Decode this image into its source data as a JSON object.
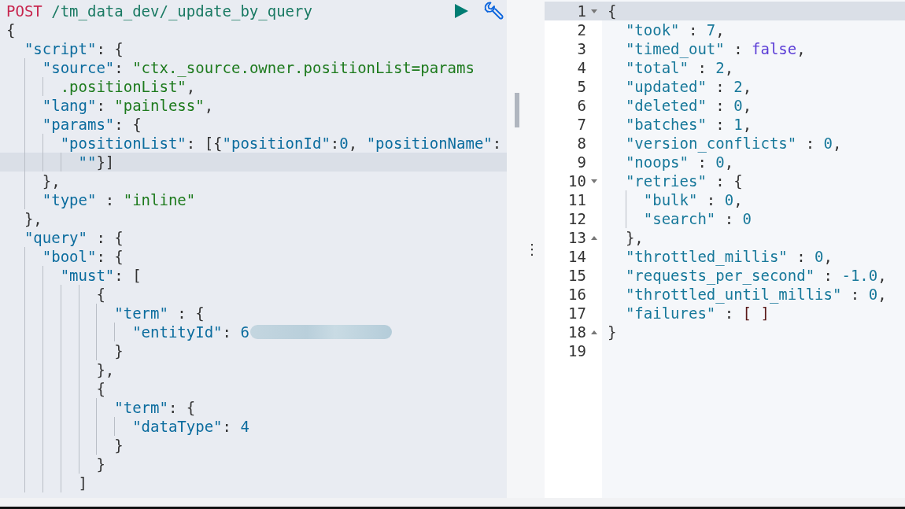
{
  "request": {
    "method": "POST",
    "url": "/tm_data_dev/_update_by_query"
  },
  "request_lines": [
    {
      "active": false,
      "segments": [
        {
          "kind": "punc",
          "text": "{"
        }
      ]
    },
    {
      "active": false,
      "segments": [
        {
          "kind": "key",
          "text": "  \"script\""
        },
        {
          "kind": "punc",
          "text": ": {"
        }
      ]
    },
    {
      "active": false,
      "segments": [
        {
          "kind": "key",
          "text": "    \"source\""
        },
        {
          "kind": "punc",
          "text": ": "
        },
        {
          "kind": "str",
          "text": "\"ctx._source.owner.positionList=params"
        }
      ]
    },
    {
      "active": false,
      "segments": [
        {
          "kind": "str",
          "text": "      .positionList\""
        },
        {
          "kind": "punc",
          "text": ","
        }
      ]
    },
    {
      "active": false,
      "segments": [
        {
          "kind": "key",
          "text": "    \"lang\""
        },
        {
          "kind": "punc",
          "text": ": "
        },
        {
          "kind": "str",
          "text": "\"painless\""
        },
        {
          "kind": "punc",
          "text": ","
        }
      ]
    },
    {
      "active": false,
      "segments": [
        {
          "kind": "key",
          "text": "    \"params\""
        },
        {
          "kind": "punc",
          "text": ": {"
        }
      ]
    },
    {
      "active": false,
      "segments": [
        {
          "kind": "key",
          "text": "      \"positionList\""
        },
        {
          "kind": "punc",
          "text": ": [{"
        },
        {
          "kind": "key",
          "text": "\"positionId\""
        },
        {
          "kind": "punc",
          "text": ":"
        },
        {
          "kind": "num",
          "text": "0"
        },
        {
          "kind": "punc",
          "text": ", "
        },
        {
          "kind": "key",
          "text": "\"positionName\""
        },
        {
          "kind": "punc",
          "text": ":"
        }
      ]
    },
    {
      "active": true,
      "segments": [
        {
          "kind": "key",
          "text": "        \"\""
        },
        {
          "kind": "punc",
          "text": "}]"
        }
      ]
    },
    {
      "active": false,
      "segments": [
        {
          "kind": "punc",
          "text": "    },"
        }
      ]
    },
    {
      "active": false,
      "segments": [
        {
          "kind": "key",
          "text": "    \"type\""
        },
        {
          "kind": "punc",
          "text": " : "
        },
        {
          "kind": "str",
          "text": "\"inline\""
        }
      ]
    },
    {
      "active": false,
      "segments": [
        {
          "kind": "punc",
          "text": "  },"
        }
      ]
    },
    {
      "active": false,
      "segments": [
        {
          "kind": "key",
          "text": "  \"query\""
        },
        {
          "kind": "punc",
          "text": " : {"
        }
      ]
    },
    {
      "active": false,
      "segments": [
        {
          "kind": "key",
          "text": "    \"bool\""
        },
        {
          "kind": "punc",
          "text": ": {"
        }
      ]
    },
    {
      "active": false,
      "segments": [
        {
          "kind": "key",
          "text": "      \"must\""
        },
        {
          "kind": "punc",
          "text": ": ["
        }
      ]
    },
    {
      "active": false,
      "segments": [
        {
          "kind": "punc",
          "text": "          {"
        }
      ]
    },
    {
      "active": false,
      "segments": [
        {
          "kind": "key",
          "text": "            \"term\""
        },
        {
          "kind": "punc",
          "text": " : {"
        }
      ]
    },
    {
      "active": false,
      "redacted": true,
      "segments": [
        {
          "kind": "key",
          "text": "              \"entityId\""
        },
        {
          "kind": "punc",
          "text": ": "
        },
        {
          "kind": "num",
          "text": "6"
        }
      ]
    },
    {
      "active": false,
      "segments": [
        {
          "kind": "punc",
          "text": "            }"
        }
      ]
    },
    {
      "active": false,
      "segments": [
        {
          "kind": "punc",
          "text": "          },"
        }
      ]
    },
    {
      "active": false,
      "segments": [
        {
          "kind": "punc",
          "text": "          {"
        }
      ]
    },
    {
      "active": false,
      "segments": [
        {
          "kind": "key",
          "text": "            \"term\""
        },
        {
          "kind": "punc",
          "text": ": {"
        }
      ]
    },
    {
      "active": false,
      "segments": [
        {
          "kind": "key",
          "text": "              \"dataType\""
        },
        {
          "kind": "punc",
          "text": ": "
        },
        {
          "kind": "num",
          "text": "4"
        }
      ]
    },
    {
      "active": false,
      "segments": [
        {
          "kind": "punc",
          "text": "            }"
        }
      ]
    },
    {
      "active": false,
      "segments": [
        {
          "kind": "punc",
          "text": "          }"
        }
      ]
    },
    {
      "active": false,
      "segments": [
        {
          "kind": "punc",
          "text": "        ]"
        }
      ]
    }
  ],
  "response_lines": [
    {
      "number": "1",
      "expanded": true,
      "active": true,
      "segments": [
        {
          "kind": "punc",
          "text": "{"
        }
      ]
    },
    {
      "number": "2",
      "active": false,
      "segments": [
        {
          "kind": "key",
          "text": "  \"took\""
        },
        {
          "kind": "punc",
          "text": " : "
        },
        {
          "kind": "num",
          "text": "7"
        },
        {
          "kind": "punc",
          "text": ","
        }
      ]
    },
    {
      "number": "3",
      "active": false,
      "segments": [
        {
          "kind": "key",
          "text": "  \"timed_out\""
        },
        {
          "kind": "punc",
          "text": " : "
        },
        {
          "kind": "bool",
          "text": "false"
        },
        {
          "kind": "punc",
          "text": ","
        }
      ]
    },
    {
      "number": "4",
      "active": false,
      "segments": [
        {
          "kind": "key",
          "text": "  \"total\""
        },
        {
          "kind": "punc",
          "text": " : "
        },
        {
          "kind": "num",
          "text": "2"
        },
        {
          "kind": "punc",
          "text": ","
        }
      ]
    },
    {
      "number": "5",
      "active": false,
      "segments": [
        {
          "kind": "key",
          "text": "  \"updated\""
        },
        {
          "kind": "punc",
          "text": " : "
        },
        {
          "kind": "num",
          "text": "2"
        },
        {
          "kind": "punc",
          "text": ","
        }
      ]
    },
    {
      "number": "6",
      "active": false,
      "segments": [
        {
          "kind": "key",
          "text": "  \"deleted\""
        },
        {
          "kind": "punc",
          "text": " : "
        },
        {
          "kind": "num",
          "text": "0"
        },
        {
          "kind": "punc",
          "text": ","
        }
      ]
    },
    {
      "number": "7",
      "active": false,
      "segments": [
        {
          "kind": "key",
          "text": "  \"batches\""
        },
        {
          "kind": "punc",
          "text": " : "
        },
        {
          "kind": "num",
          "text": "1"
        },
        {
          "kind": "punc",
          "text": ","
        }
      ]
    },
    {
      "number": "8",
      "active": false,
      "segments": [
        {
          "kind": "key",
          "text": "  \"version_conflicts\""
        },
        {
          "kind": "punc",
          "text": " : "
        },
        {
          "kind": "num",
          "text": "0"
        },
        {
          "kind": "punc",
          "text": ","
        }
      ]
    },
    {
      "number": "9",
      "active": false,
      "segments": [
        {
          "kind": "key",
          "text": "  \"noops\""
        },
        {
          "kind": "punc",
          "text": " : "
        },
        {
          "kind": "num",
          "text": "0"
        },
        {
          "kind": "punc",
          "text": ","
        }
      ]
    },
    {
      "number": "10",
      "expanded": true,
      "active": false,
      "segments": [
        {
          "kind": "key",
          "text": "  \"retries\""
        },
        {
          "kind": "punc",
          "text": " : {"
        }
      ]
    },
    {
      "number": "11",
      "active": false,
      "segments": [
        {
          "kind": "key",
          "text": "    \"bulk\""
        },
        {
          "kind": "punc",
          "text": " : "
        },
        {
          "kind": "num",
          "text": "0"
        },
        {
          "kind": "punc",
          "text": ","
        }
      ]
    },
    {
      "number": "12",
      "active": false,
      "segments": [
        {
          "kind": "key",
          "text": "    \"search\""
        },
        {
          "kind": "punc",
          "text": " : "
        },
        {
          "kind": "num",
          "text": "0"
        }
      ]
    },
    {
      "number": "13",
      "fold_end": true,
      "active": false,
      "segments": [
        {
          "kind": "punc",
          "text": "  },"
        }
      ]
    },
    {
      "number": "14",
      "active": false,
      "segments": [
        {
          "kind": "key",
          "text": "  \"throttled_millis\""
        },
        {
          "kind": "punc",
          "text": " : "
        },
        {
          "kind": "num",
          "text": "0"
        },
        {
          "kind": "punc",
          "text": ","
        }
      ]
    },
    {
      "number": "15",
      "active": false,
      "segments": [
        {
          "kind": "key",
          "text": "  \"requests_per_second\""
        },
        {
          "kind": "punc",
          "text": " : "
        },
        {
          "kind": "num",
          "text": "-1.0"
        },
        {
          "kind": "punc",
          "text": ","
        }
      ]
    },
    {
      "number": "16",
      "active": false,
      "segments": [
        {
          "kind": "key",
          "text": "  \"throttled_until_millis\""
        },
        {
          "kind": "punc",
          "text": " : "
        },
        {
          "kind": "num",
          "text": "0"
        },
        {
          "kind": "punc",
          "text": ","
        }
      ]
    },
    {
      "number": "17",
      "active": false,
      "segments": [
        {
          "kind": "key",
          "text": "  \"failures\""
        },
        {
          "kind": "punc",
          "text": " : "
        },
        {
          "kind": "brk",
          "text": "[ ]"
        }
      ]
    },
    {
      "number": "18",
      "fold_end": true,
      "active": false,
      "segments": [
        {
          "kind": "punc",
          "text": "}"
        }
      ]
    },
    {
      "number": "19",
      "active": false
    }
  ],
  "resize_handle": "⋮"
}
